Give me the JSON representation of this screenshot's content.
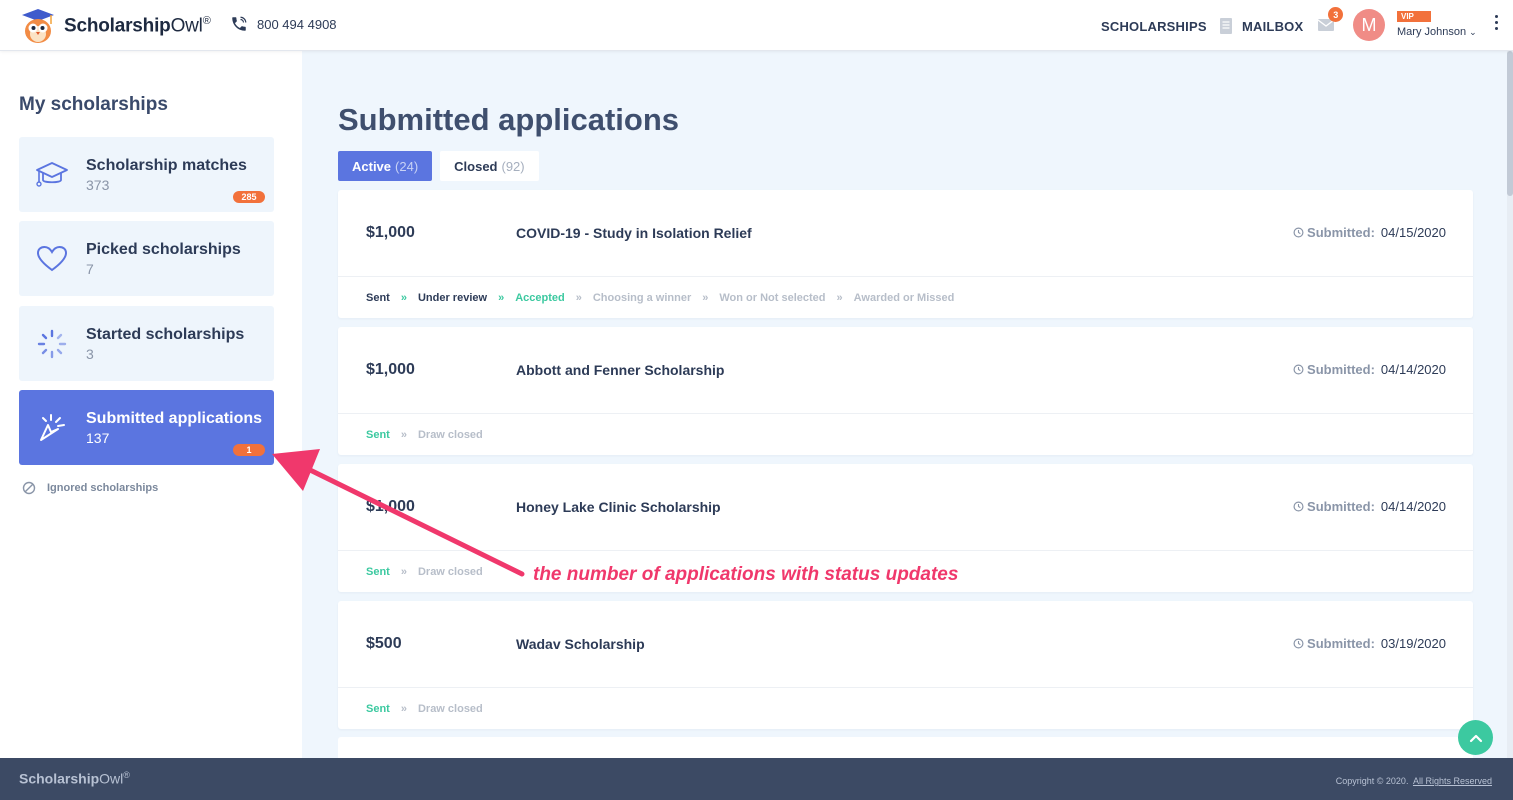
{
  "header": {
    "logo_bold": "Scholarship",
    "logo_light": "Owl",
    "logo_reg": "®",
    "phone": "800 494 4908",
    "nav_scholarships": "SCHOLARSHIPS",
    "nav_mailbox": "MAILBOX",
    "mail_count": "3",
    "avatar_initial": "M",
    "vip": "VIP",
    "user_name": "Mary Johnson",
    "user_chevron": "⌄"
  },
  "sidebar": {
    "title": "My scholarships",
    "items": [
      {
        "label": "Scholarship matches",
        "count": "373",
        "badge": "285",
        "icon": "graduation-cap-icon"
      },
      {
        "label": "Picked scholarships",
        "count": "7",
        "icon": "heart-icon"
      },
      {
        "label": "Started scholarships",
        "count": "3",
        "icon": "spinner-icon"
      },
      {
        "label": "Submitted applications",
        "count": "137",
        "badge": "1",
        "icon": "cursor-click-icon",
        "active": true
      }
    ],
    "ignored": "Ignored scholarships"
  },
  "main": {
    "title": "Submitted applications",
    "tabs": [
      {
        "label": "Active",
        "count": "(24)",
        "active": true
      },
      {
        "label": "Closed",
        "count": "(92)",
        "active": false
      }
    ],
    "submitted_label": "Submitted:",
    "applications": [
      {
        "amount": "$1,000",
        "name": "COVID-19 - Study in Isolation Relief",
        "date": "04/15/2020",
        "statuses": [
          "Sent",
          "Under review",
          "Accepted",
          "Choosing a winner",
          "Won or Not selected",
          "Awarded or Missed"
        ]
      },
      {
        "amount": "$1,000",
        "name": "Abbott and Fenner Scholarship",
        "date": "04/14/2020",
        "statuses": [
          "Sent",
          "Draw closed"
        ]
      },
      {
        "amount": "$1,000",
        "name": "Honey Lake Clinic Scholarship",
        "date": "04/14/2020",
        "statuses": [
          "Sent",
          "Draw closed"
        ]
      },
      {
        "amount": "$500",
        "name": "Wadav Scholarship",
        "date": "03/19/2020",
        "statuses": [
          "Sent",
          "Draw closed"
        ]
      }
    ],
    "status_separator": "»"
  },
  "annotation": {
    "text": "the number of applications with status updates"
  },
  "footer": {
    "logo_bold": "Scholarship",
    "logo_light": "Owl",
    "logo_reg": "®",
    "copyright": "Copyright © 2020.",
    "rights": "All Rights Reserved"
  },
  "colors": {
    "accent": "#5b75e0",
    "badge": "#f2713b",
    "status_green": "#3cc9a0",
    "annotation": "#f0386c",
    "footer_bg": "#3c4a64",
    "main_bg": "#eff6fd"
  }
}
